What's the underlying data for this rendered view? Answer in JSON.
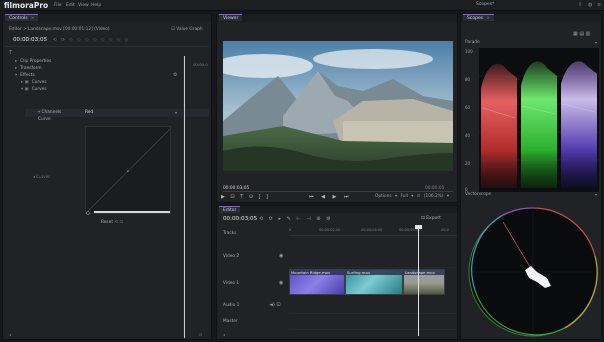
{
  "app": {
    "logo": "filmoraPro",
    "menu": [
      "File",
      "Edit",
      "View",
      "Help"
    ],
    "window_title": "Scopes*"
  },
  "controls": {
    "tab": "Controls",
    "path": "Editor > Landscape.mov [00:00:01:12] (Video)",
    "timecode": "00:00:03;05",
    "value_graph": "Value Graph",
    "time0": "00:00:0",
    "tree": [
      "Clip Properties",
      "Transform",
      "Effects",
      "Curves",
      "Curves"
    ],
    "channel_label": "Channels",
    "channel_value": "Red",
    "curve_label": "Curve",
    "side_label": "Curves",
    "reset": "Reset"
  },
  "viewer": {
    "tab": "Viewer",
    "timecode": "00:00:03;05",
    "timecode_right": "00:00:05",
    "options": "Options",
    "full": "Full",
    "zoom": "(106.2%)"
  },
  "editor": {
    "tab": "Editor",
    "timecode": "00:00:03;05",
    "export": "Export",
    "tracks_label": "Tracks",
    "ruler": [
      "0",
      "00:00:02:00",
      "00:00:04:00",
      "00:00:05:00",
      "00:0"
    ],
    "tracks": [
      "Video 2",
      "Video 1",
      "Audio 1",
      "Master"
    ],
    "clips": [
      {
        "name": "Mountain Ridge.mov",
        "color": "#6a5fd0"
      },
      {
        "name": "Surfing.mov",
        "color": "#3aa7b0"
      },
      {
        "name": "Landscape.mov",
        "color": "#7f8fa0"
      }
    ]
  },
  "scopes": {
    "tab": "Scopes",
    "parade_label": "Parade",
    "parade_axis": [
      "100",
      "80",
      "60",
      "40",
      "20",
      "0"
    ],
    "vectorscope_label": "Vectorscope"
  },
  "colors": {
    "accent": "#8a5cf6",
    "panel": "#202226",
    "background": "#16181c"
  }
}
